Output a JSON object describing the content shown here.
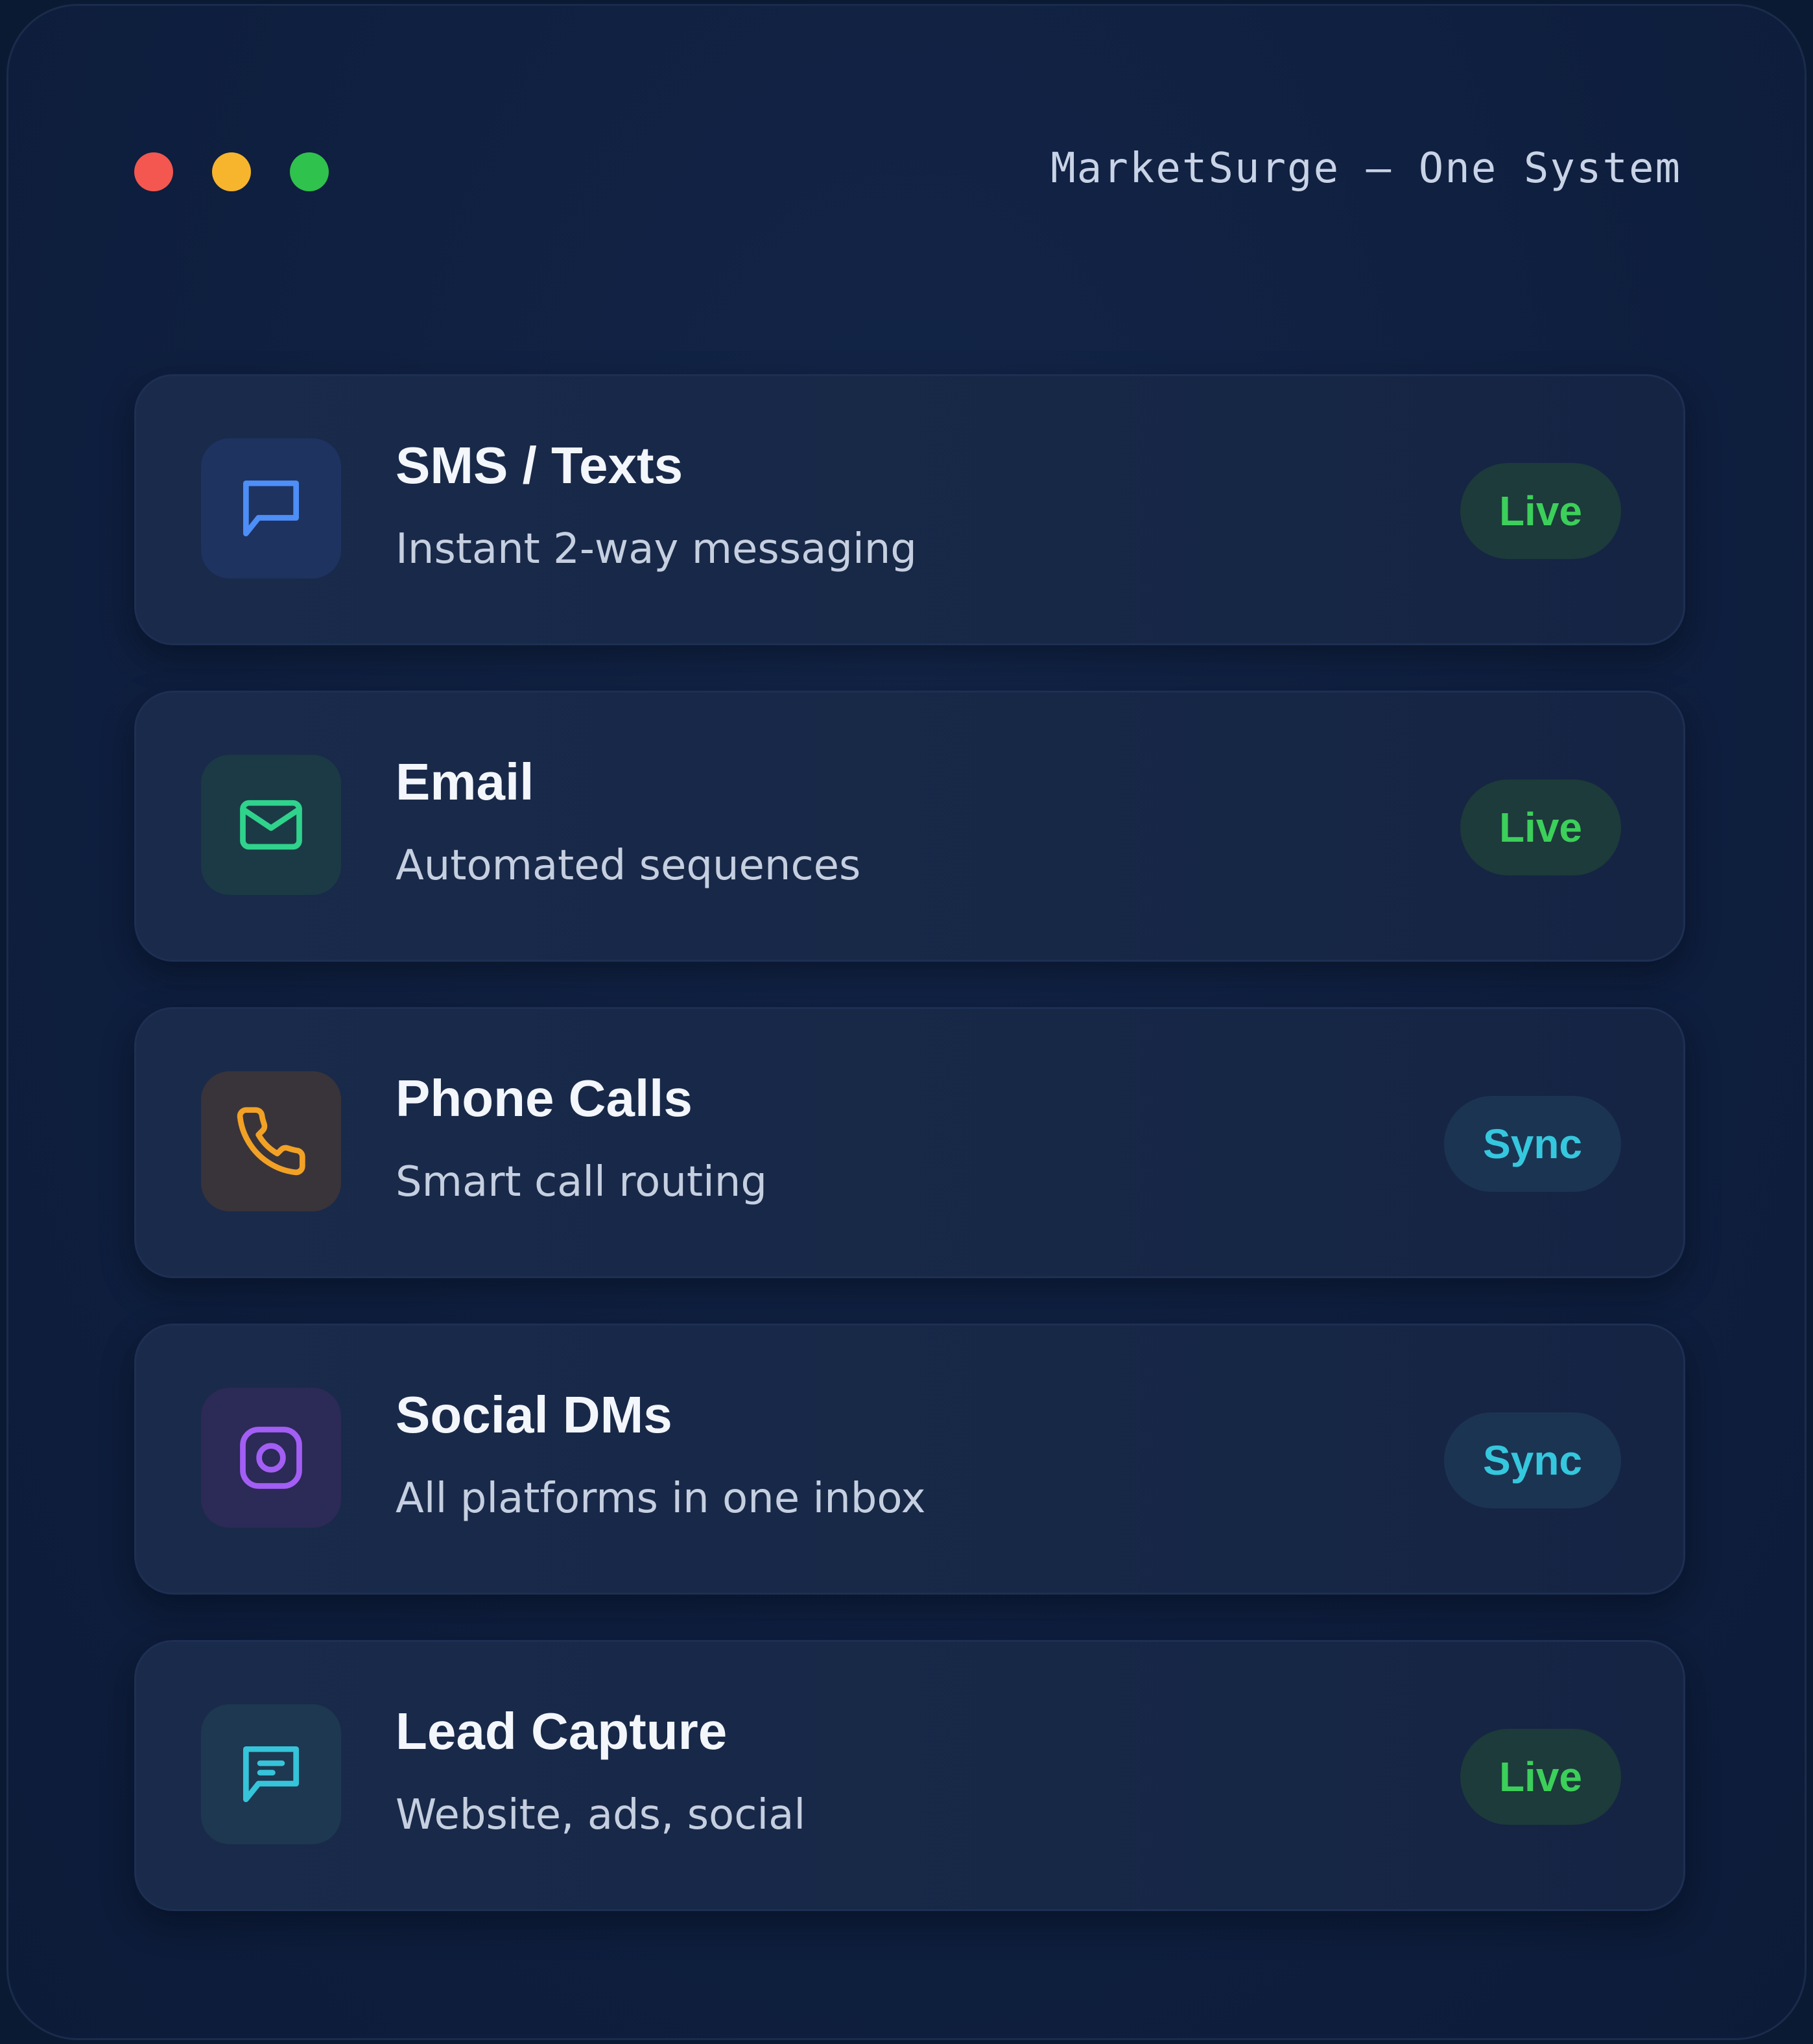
{
  "window": {
    "title": "MarketSurge — One System",
    "controls": [
      "close",
      "minimize",
      "zoom"
    ]
  },
  "channels": [
    {
      "title": "SMS / Texts",
      "subtitle": "Instant 2-way messaging",
      "status": "Live",
      "icon": "message-square-icon",
      "icon_color": "#4d8ef7",
      "tile_color": "#1e3360",
      "badge_bg": "#1c3b3a",
      "badge_color": "#3ccf5a"
    },
    {
      "title": "Email",
      "subtitle": "Automated sequences",
      "status": "Live",
      "icon": "mail-icon",
      "icon_color": "#2fd38c",
      "tile_color": "#1b3a45",
      "badge_bg": "#1c3b3a",
      "badge_color": "#3ccf5a"
    },
    {
      "title": "Phone Calls",
      "subtitle": "Smart call routing",
      "status": "Sync",
      "icon": "phone-icon",
      "icon_color": "#f2a125",
      "tile_color": "#39343a",
      "badge_bg": "#1b3452",
      "badge_color": "#35c7dd"
    },
    {
      "title": "Social DMs",
      "subtitle": "All platforms in one inbox",
      "status": "Sync",
      "icon": "instagram-icon",
      "icon_color": "#a35ef5",
      "tile_color": "#2c2a56",
      "badge_bg": "#1b3452",
      "badge_color": "#35c7dd"
    },
    {
      "title": "Lead Capture",
      "subtitle": "Website, ads, social",
      "status": "Live",
      "icon": "message-lines-icon",
      "icon_color": "#36c4da",
      "tile_color": "#1d3850",
      "badge_bg": "#1c3b3a",
      "badge_color": "#3ccf5a"
    }
  ]
}
